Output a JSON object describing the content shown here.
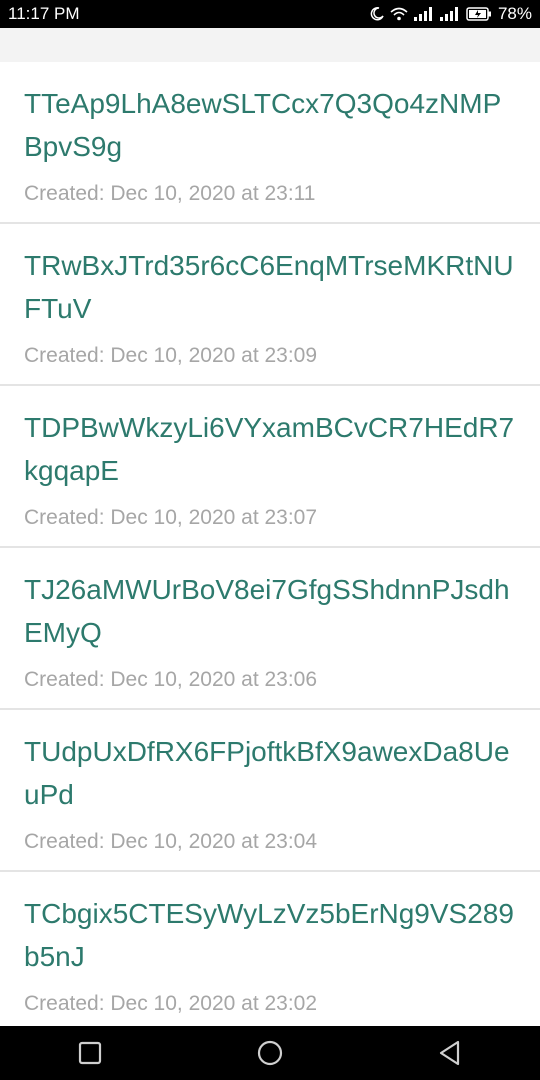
{
  "status_bar": {
    "time": "11:17 PM",
    "battery_percent": "78%",
    "icons": [
      "moon-icon",
      "wifi-icon",
      "signal-icon",
      "signal-icon",
      "battery-charging-icon"
    ]
  },
  "header": {
    "partial_text": ""
  },
  "addresses": [
    {
      "address": "TTeAp9LhA8ewSLTCcx7Q3Qo4zNMPBpvS9g",
      "created": "Created: Dec 10, 2020 at 23:11"
    },
    {
      "address": "TRwBxJTrd35r6cC6EnqMTrseMKRtNUFTuV",
      "created": "Created: Dec 10, 2020 at 23:09"
    },
    {
      "address": "TDPBwWkzyLi6VYxamBCvCR7HEdR7kgqapE",
      "created": "Created: Dec 10, 2020 at 23:07"
    },
    {
      "address": "TJ26aMWUrBoV8ei7GfgSShdnnPJsdhEMyQ",
      "created": "Created: Dec 10, 2020 at 23:06"
    },
    {
      "address": "TUdpUxDfRX6FPjoftkBfX9awexDa8UeuPd",
      "created": "Created: Dec 10, 2020 at 23:04"
    },
    {
      "address": "TCbgix5CTESyWyLzVz5bErNg9VS289b5nJ",
      "created": "Created: Dec 10, 2020 at 23:02"
    }
  ],
  "nav_bar": {
    "icons": [
      "recents-square-icon",
      "home-circle-icon",
      "back-triangle-icon"
    ]
  },
  "colors": {
    "address": "#2d7a6d",
    "created": "#a6a6a6",
    "divider": "#e4e4e4"
  }
}
